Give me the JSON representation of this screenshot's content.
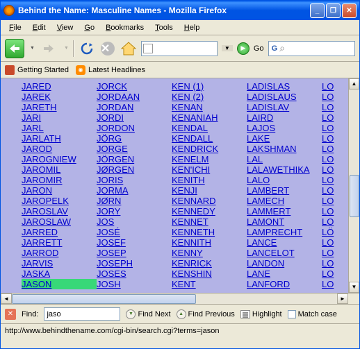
{
  "window": {
    "title": "Behind the Name: Masculine Names - Mozilla Firefox"
  },
  "menu": {
    "file": "File",
    "edit": "Edit",
    "view": "View",
    "go": "Go",
    "bookmarks": "Bookmarks",
    "tools": "Tools",
    "help": "Help"
  },
  "toolbar": {
    "go_label": "Go"
  },
  "bookmarks": {
    "getting_started": "Getting Started",
    "latest_headlines": "Latest Headlines"
  },
  "names": {
    "col1": [
      "JARED",
      "JAREK",
      "JARETH",
      "JARI",
      "JARL",
      "JARLATH",
      "JAROD",
      "JAROGNIEW",
      "JAROMIL",
      "JAROMIR",
      "JARON",
      "JAROPELK",
      "JAROSLAV",
      "JAROSLAW",
      "JARRED",
      "JARRETT",
      "JARROD",
      "JARVIS",
      "JASKA",
      "JASON"
    ],
    "col2": [
      "JORCK",
      "JORDAAN",
      "JORDAN",
      "JORDI",
      "JORDON",
      "JÖRG",
      "JORGE",
      "JÖRGEN",
      "JØRGEN",
      "JORIS",
      "JORMA",
      "JØRN",
      "JORY",
      "JOS",
      "JOSÉ",
      "JOSEF",
      "JOSEP",
      "JOSEPH",
      "JOSES",
      "JOSH"
    ],
    "col3": [
      "KEN (1)",
      "KEN (2)",
      "KENAN",
      "KENANIAH",
      "KENDAL",
      "KENDALL",
      "KENDRICK",
      "KENELM",
      "KEN'ICHI",
      "KENITH",
      "KENJI",
      "KENNARD",
      "KENNEDY",
      "KENNET",
      "KENNETH",
      "KENNITH",
      "KENNY",
      "KENRICK",
      "KENSHIN",
      "KENT"
    ],
    "col4": [
      "LADISLAS",
      "LADISLAUS",
      "LADISLAV",
      "LAIRD",
      "LAJOS",
      "LAKE",
      "LAKSHMAN",
      "LAL",
      "LALAWETHIKA",
      "LALO",
      "LAMBERT",
      "LAMECH",
      "LAMMERT",
      "LAMONT",
      "LAMPRECHT",
      "LANCE",
      "LANCELOT",
      "LANDON",
      "LANE",
      "LANFORD"
    ],
    "col5": [
      "LO",
      "LO",
      "LO",
      "LO",
      "LO",
      "LO",
      "LO",
      "LO",
      "LO",
      "LO",
      "LO",
      "LO",
      "LO",
      "LO",
      "LÖ",
      "LO",
      "LO",
      "LO",
      "LO",
      "LO"
    ]
  },
  "find": {
    "label": "Find:",
    "value": "jaso",
    "next": "Find Next",
    "previous": "Find Previous",
    "highlight": "Highlight",
    "match_case": "Match case"
  },
  "status": {
    "url": "http://www.behindthename.com/cgi-bin/search.cgi?terms=jason"
  }
}
